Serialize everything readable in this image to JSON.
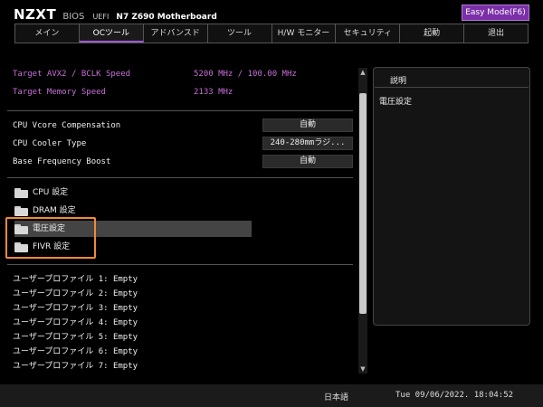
{
  "header": {
    "logo": "NZXT",
    "bios": "BIOS",
    "uefi": "UEFI",
    "model": "N7 Z690 Motherboard",
    "easy_mode": "Easy Mode(F6)"
  },
  "tabs": [
    {
      "label": "メイン",
      "active": false
    },
    {
      "label": "OCツール",
      "active": true
    },
    {
      "label": "アドバンスド",
      "active": false
    },
    {
      "label": "ツール",
      "active": false
    },
    {
      "label": "H/W モニター",
      "active": false
    },
    {
      "label": "セキュリティ",
      "active": false
    },
    {
      "label": "起動",
      "active": false
    },
    {
      "label": "退出",
      "active": false
    }
  ],
  "info": [
    {
      "label": "Target AVX2 / BCLK Speed",
      "value": "5200 MHz / 100.00 MHz"
    },
    {
      "label": "Target Memory Speed",
      "value": "2133 MHz"
    }
  ],
  "settings": [
    {
      "label": "CPU Vcore Compensation",
      "value": "自動"
    },
    {
      "label": "CPU Cooler Type",
      "value": "240-280mmラジ..."
    },
    {
      "label": "Base Frequency Boost",
      "value": "自動"
    }
  ],
  "folders": [
    {
      "label": "CPU 設定",
      "icon": "folder-icon"
    },
    {
      "label": "DRAM 設定",
      "icon": "folder-icon"
    },
    {
      "label": "電圧設定",
      "icon": "folder-icon",
      "selected": true
    },
    {
      "label": "FIVR 設定",
      "icon": "folder-icon"
    }
  ],
  "profiles": [
    "ユーザープロファイル 1: Empty",
    "ユーザープロファイル 2: Empty",
    "ユーザープロファイル 3: Empty",
    "ユーザープロファイル 4: Empty",
    "ユーザープロファイル 5: Empty",
    "ユーザープロファイル 6: Empty",
    "ユーザープロファイル 7: Empty"
  ],
  "scrollbar": {
    "up": "▲",
    "down": "▼"
  },
  "description": {
    "title": "説明",
    "text": "電圧設定"
  },
  "footer": {
    "language": "日本語",
    "datetime": "Tue 09/06/2022. 18:04:52"
  },
  "colors": {
    "accent": "#7b2fa8",
    "info_text": "#c86fd8",
    "highlight": "#f08a3a"
  }
}
